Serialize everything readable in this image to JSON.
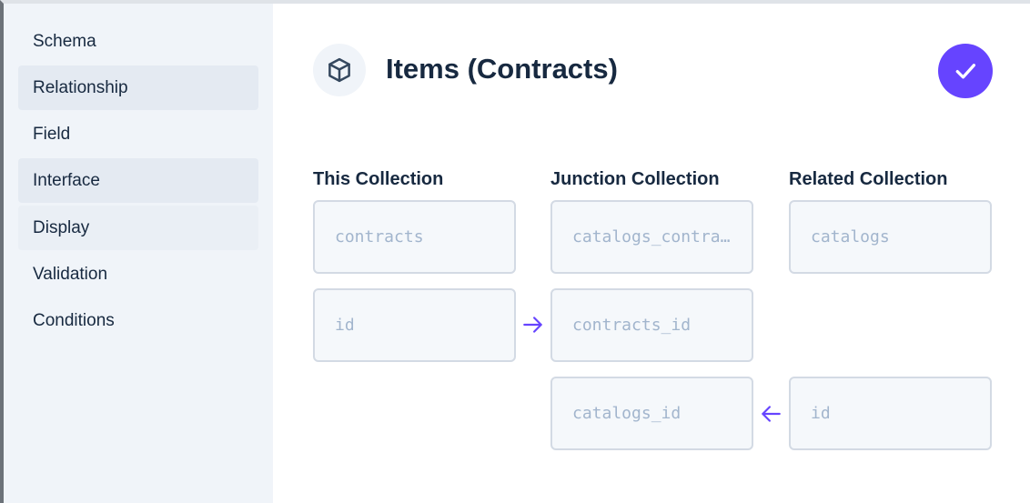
{
  "sidebar": {
    "items": [
      {
        "label": "Schema"
      },
      {
        "label": "Relationship"
      },
      {
        "label": "Field"
      },
      {
        "label": "Interface"
      },
      {
        "label": "Display"
      },
      {
        "label": "Validation"
      },
      {
        "label": "Conditions"
      }
    ]
  },
  "header": {
    "icon": "cube-icon",
    "title": "Items (Contracts)",
    "save_icon": "check-icon"
  },
  "columns": {
    "this": {
      "label": "This Collection",
      "collection": "contracts",
      "field": "id"
    },
    "junction": {
      "label": "Junction Collection",
      "collection": "catalogs_contracts",
      "this_field": "contracts_id",
      "related_field": "catalogs_id"
    },
    "related": {
      "label": "Related Collection",
      "collection": "catalogs",
      "field": "id"
    }
  },
  "colors": {
    "accent": "#6644ff",
    "sidebar_bg": "#f0f4f9",
    "field_text": "#a2b5cd"
  }
}
